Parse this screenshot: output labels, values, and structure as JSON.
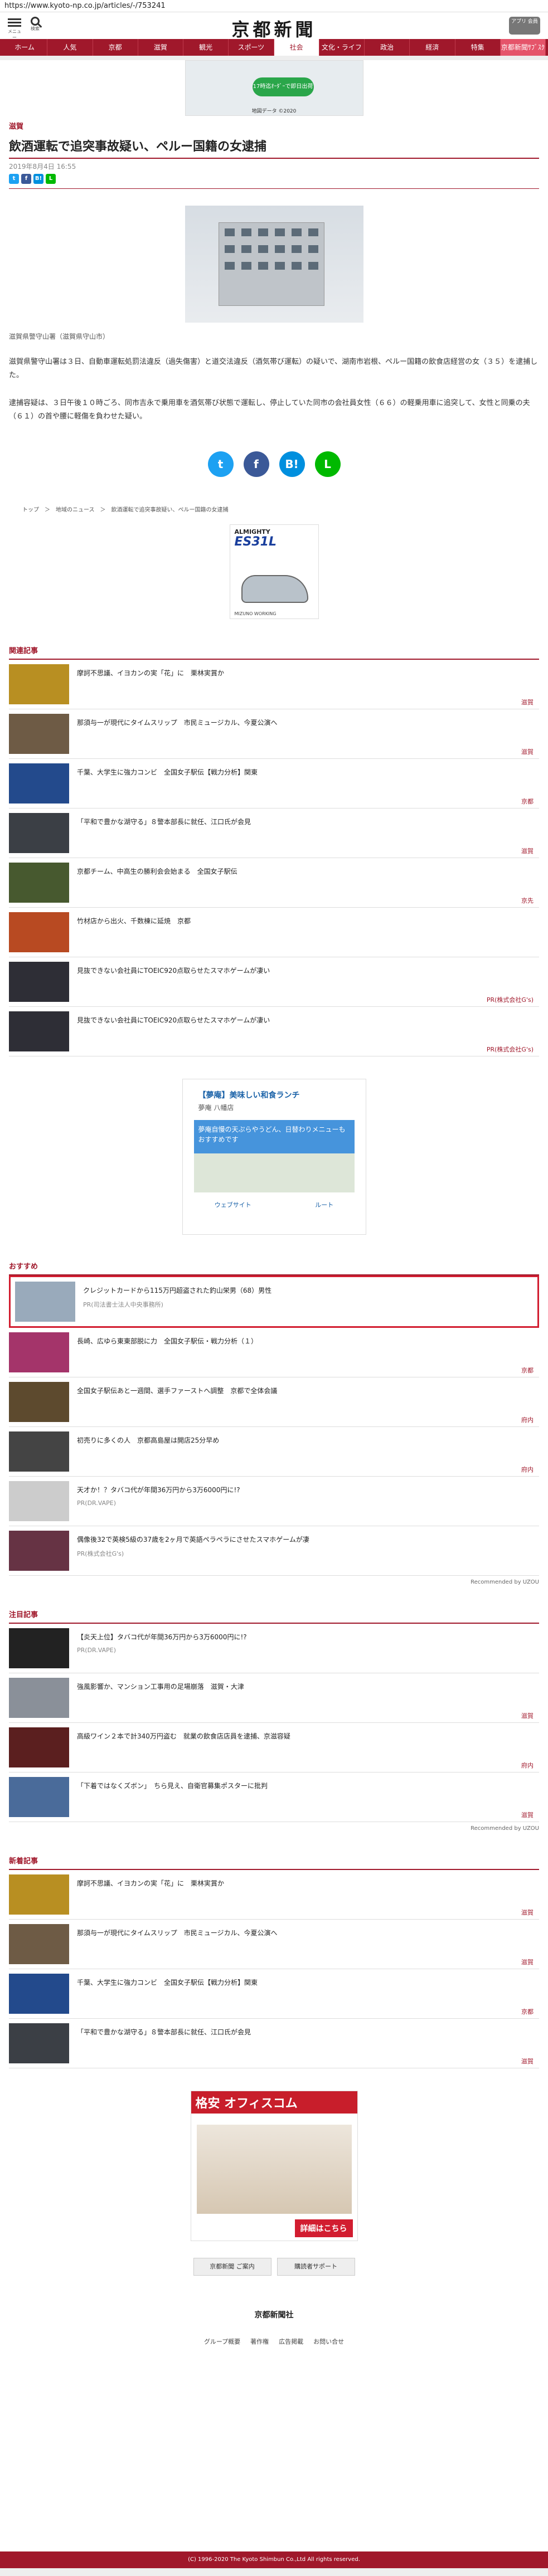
{
  "url": "https://www.kyoto-np.co.jp/articles/-/753241",
  "header": {
    "menu_label": "メニュー",
    "search_label": "検索",
    "logo": "京都新聞",
    "app_button": "アプリ\n会員"
  },
  "nav": [
    "ホーム",
    "人気",
    "京都",
    "滋賀",
    "観光",
    "スポーツ",
    "社会",
    "文化・ライフ",
    "政治",
    "経済",
    "特集",
    "京都新聞ｻﾌﾞｽｸ"
  ],
  "ad_top": {
    "button": "17時迄ｵｰﾀﾞｰで即日出荷",
    "caption": "地図データ ©2020"
  },
  "article": {
    "category": "滋賀",
    "title": "飲酒運転で追突事故疑い、ペルー国籍の女逮捕",
    "date": "2019年8月4日 16:55",
    "caption": "滋賀県警守山署（滋賀県守山市）",
    "p1": "滋賀県警守山署は３日、自動車運転処罰法違反（過失傷害）と道交法違反（酒気帯び運転）の疑いで、湖南市岩根、ペルー国籍の飲食店経営の女（３５）を逮捕した。",
    "p2": "逮捕容疑は、３日午後１０時ごろ、同市吉永で乗用車を酒気帯び状態で運転し、停止していた同市の会社員女性（６６）の軽乗用車に追突して、女性と同乗の夫（６１）の首や腰に軽傷を負わせた疑い。"
  },
  "share": {
    "tw": "t",
    "fb": "f",
    "hb": "B!",
    "line": "L"
  },
  "breadcrumb": "トップ　＞　地域のニュース　＞　飲酒運転で追突事故疑い、ペルー国籍の女逮捕",
  "shoe_ad": {
    "t1": "ALMIGHTY",
    "t2": "ES31L",
    "foot": "MIZUNO WORKING"
  },
  "related_title": "関連記事",
  "related": [
    {
      "text": "摩訶不思議、イヨカンの実「花」に　栗林実賞か",
      "tag": "滋賀",
      "color": "#b88f22"
    },
    {
      "text": "那須与一が現代にタイムスリップ　市民ミュージカル、今夏公演へ",
      "tag": "滋賀",
      "color": "#6e5b45"
    },
    {
      "text": "千葉、大学生に強力コンビ　全国女子駅伝【戦力分析】関東",
      "tag": "京都",
      "color": "#234a8c"
    },
    {
      "text": "「平和で豊かな湖守る」８警本部長に就任、江口氏が会見",
      "tag": "滋賀",
      "color": "#3b3f45"
    },
    {
      "text": "京都チーム、中高生の勝利会会始まる　全国女子駅伝",
      "tag": "京先",
      "color": "#47592f"
    },
    {
      "text": "竹材店から出火、千数棟に延焼　京都",
      "tag": "",
      "color": "#b84a22"
    },
    {
      "text": "見抜できない会社員にTOEIC920点取らせたスマホゲームが凄い",
      "tag": "PR(株式会社G's)",
      "color": "#2e2e36"
    },
    {
      "text": "見抜できない会社員にTOEIC920点取らせたスマホゲームが凄い",
      "tag": "PR(株式会社G's)",
      "color": "#2e2e36"
    }
  ],
  "map_ad": {
    "title": "【夢庵】美味しい和食ランチ",
    "sub": "夢庵 八幡店",
    "blue": "夢庵自慢の天ぷらやうどん、日替わりメニューもおすすめです",
    "b1": "ウェブサイト",
    "b2": "ルート"
  },
  "rec_title": "おすすめ",
  "rec": [
    {
      "text": "クレジットカードから115万円超盗された釣山栄男（68）男性",
      "pr": "PR(司法書士法人中央事務所)",
      "color": "#9ab"
    },
    {
      "text": "長崎、広ゆら東東部脱に力　全国女子駅伝・戦力分析（１）",
      "tag": "京都",
      "color": "#a4346a"
    },
    {
      "text": "全国女子駅伝あと一週間、選手ファーストへ調整　京都で全体会議",
      "tag": "府内",
      "color": "#5d4a2e"
    },
    {
      "text": "初売りに多くの人　京都高島屋は開店25分早め",
      "tag": "府内",
      "color": "#444"
    },
    {
      "text": "天才か！？タバコ代が年間36万円から3万6000円に!?",
      "pr": "PR(DR.VAPE)",
      "color": "#ccc"
    },
    {
      "text": "偶像後32で英検5級の37歳を2ヶ月で英語ペラペラにさせたスマホゲームが凄",
      "pr": "PR(株式会社G's)",
      "color": "#634"
    }
  ],
  "recommended_by": "Recommended by UZOU",
  "notice_title": "注目記事",
  "notice": [
    {
      "text": "【炎天上位】タバコ代が年間36万円から3万6000円に!?",
      "pr": "PR(DR.VAPE)",
      "color": "#222"
    },
    {
      "text": "強風影響か、マンション工事用の足場崩落　滋賀・大津",
      "tag": "滋賀",
      "color": "#8a9099"
    },
    {
      "text": "高級ワイン２本で計340万円盗む　就業の飲食店店員を逮捕、京滋容疑",
      "tag": "府内",
      "color": "#5b1f1f"
    },
    {
      "text": "「下着ではなくズボン」　ちら見え、自衛官募集ポスターに批判",
      "tag": "滋賀",
      "color": "#4a6b9a"
    }
  ],
  "new_title": "新着記事",
  "new": [
    {
      "text": "摩訶不思議、イヨカンの実「花」に　栗林実賞か",
      "tag": "滋賀",
      "color": "#b88f22"
    },
    {
      "text": "那須与一が現代にタイムスリップ　市民ミュージカル、今夏公演へ",
      "tag": "滋賀",
      "color": "#6e5b45"
    },
    {
      "text": "千葉、大学生に強力コンビ　全国女子駅伝【戦力分析】関東",
      "tag": "京都",
      "color": "#234a8c"
    },
    {
      "text": "「平和で豊かな湖守る」８警本部長に就任、江口氏が会見",
      "tag": "滋賀",
      "color": "#3b3f45"
    }
  ],
  "big_ad": {
    "head": "格安 オフィスコム",
    "cta": "詳細はこちら"
  },
  "footer": {
    "btn1": "京都新聞 ご案内",
    "btn2": "購読者サポート",
    "logo": "京都新聞社",
    "links": [
      "グループ概要",
      "著作権",
      "広告掲載",
      "お問い合せ"
    ],
    "copyright": "(C) 1996-2020 The Kyoto Shimbun Co.,Ltd All rights reserved."
  }
}
